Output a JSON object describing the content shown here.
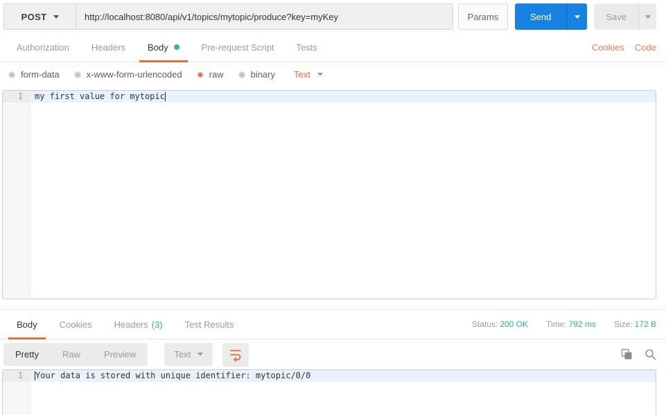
{
  "request_bar": {
    "method": "POST",
    "url": "http://localhost:8080/api/v1/topics/mytopic/produce?key=myKey",
    "params_label": "Params",
    "send_label": "Send",
    "save_label": "Save"
  },
  "request_tabs": {
    "items": [
      {
        "label": "Authorization"
      },
      {
        "label": "Headers"
      },
      {
        "label": "Body"
      },
      {
        "label": "Pre-request Script"
      },
      {
        "label": "Tests"
      }
    ],
    "active": "Body",
    "cookies_label": "Cookies",
    "code_label": "Code"
  },
  "body_type": {
    "form_data": "form-data",
    "urlencoded": "x-www-form-urlencoded",
    "raw": "raw",
    "binary": "binary",
    "selected": "raw",
    "format": "Text"
  },
  "request_editor": {
    "line_number": "1",
    "line1": "my first value for mytopic"
  },
  "response": {
    "tabs": {
      "body": "Body",
      "cookies": "Cookies",
      "headers": "Headers",
      "headers_count": "(3)",
      "test_results": "Test Results",
      "active": "Body"
    },
    "meta": {
      "status_label": "Status:",
      "status_value": "200 OK",
      "time_label": "Time:",
      "time_value": "792 ms",
      "size_label": "Size:",
      "size_value": "172 B"
    },
    "toolbar": {
      "pretty": "Pretty",
      "raw": "Raw",
      "preview": "Preview",
      "active": "Pretty",
      "format": "Text"
    },
    "editor": {
      "line_number": "1",
      "line1": "Your data is stored with unique identifier: mytopic/0/0"
    }
  },
  "colors": {
    "accent_orange": "#F0683B",
    "send_blue": "#1782E2",
    "success_green": "#2EB886",
    "link_coral": "#EE7B5C"
  }
}
